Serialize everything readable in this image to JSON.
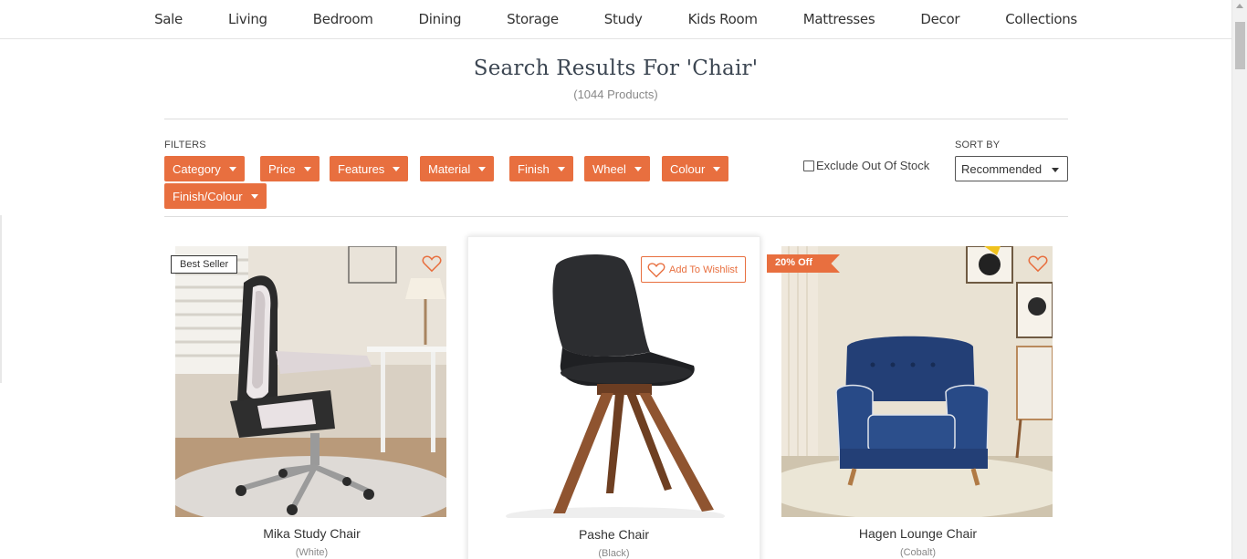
{
  "nav": {
    "items": [
      "Sale",
      "Living",
      "Bedroom",
      "Dining",
      "Storage",
      "Study",
      "Kids Room",
      "Mattresses",
      "Decor",
      "Collections"
    ]
  },
  "search": {
    "title": "Search Results For 'Chair'",
    "count": "(1044 Products)"
  },
  "filters": {
    "label": "FILTERS",
    "buttons": [
      "Category",
      "Price",
      "Features",
      "Material",
      "Finish",
      "Wheel",
      "Colour",
      "Finish/Colour"
    ]
  },
  "exclude_out_of_stock": {
    "label": "Exclude Out Of Stock",
    "checked": false
  },
  "sort": {
    "label": "SORT BY",
    "selected": "Recommended"
  },
  "products": [
    {
      "name": "Mika Study Chair",
      "variant": "(White)",
      "badge": "Best Seller"
    },
    {
      "name": "Pashe Chair",
      "variant": "(Black)",
      "wishlist_label": "Add To Wishlist"
    },
    {
      "name": "Hagen Lounge Chair",
      "variant": "(Cobalt)",
      "badge": "20% Off"
    }
  ],
  "colors": {
    "accent": "#e86f3f",
    "heading": "#3c4652",
    "text": "#333333",
    "muted": "#888888"
  }
}
